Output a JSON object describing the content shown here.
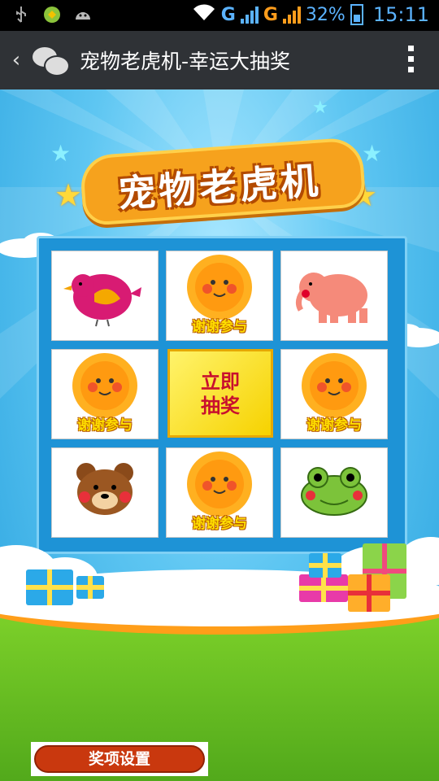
{
  "status_bar": {
    "battery_percent": "32%",
    "time": "15:11",
    "network_1": "G",
    "network_2": "G",
    "icons": [
      "usb-icon",
      "green-app-icon",
      "android-icon",
      "wifi-icon",
      "signal-icon",
      "battery-icon"
    ]
  },
  "title_bar": {
    "title": "宠物老虎机-幸运大抽奖",
    "icons": [
      "back-icon",
      "wechat-icon",
      "more-menu-icon"
    ]
  },
  "game": {
    "title": "宠物老虎机",
    "draw_button": "立即抽奖",
    "cells": [
      {
        "name": "bird",
        "caption": ""
      },
      {
        "name": "sun",
        "caption": "谢谢参与"
      },
      {
        "name": "elephant",
        "caption": ""
      },
      {
        "name": "sun",
        "caption": "谢谢参与"
      },
      {
        "name": "sun",
        "caption": "谢谢参与"
      },
      {
        "name": "bear",
        "caption": ""
      },
      {
        "name": "sun",
        "caption": "谢谢参与"
      },
      {
        "name": "frog",
        "caption": ""
      }
    ]
  },
  "settings_button": "奖项设置",
  "colors": {
    "sky": "#2aa3df",
    "panel": "#1e93d6",
    "button_red": "#c9380e",
    "grass": "#6cc023",
    "draw_button_bg": "#f6d200"
  }
}
